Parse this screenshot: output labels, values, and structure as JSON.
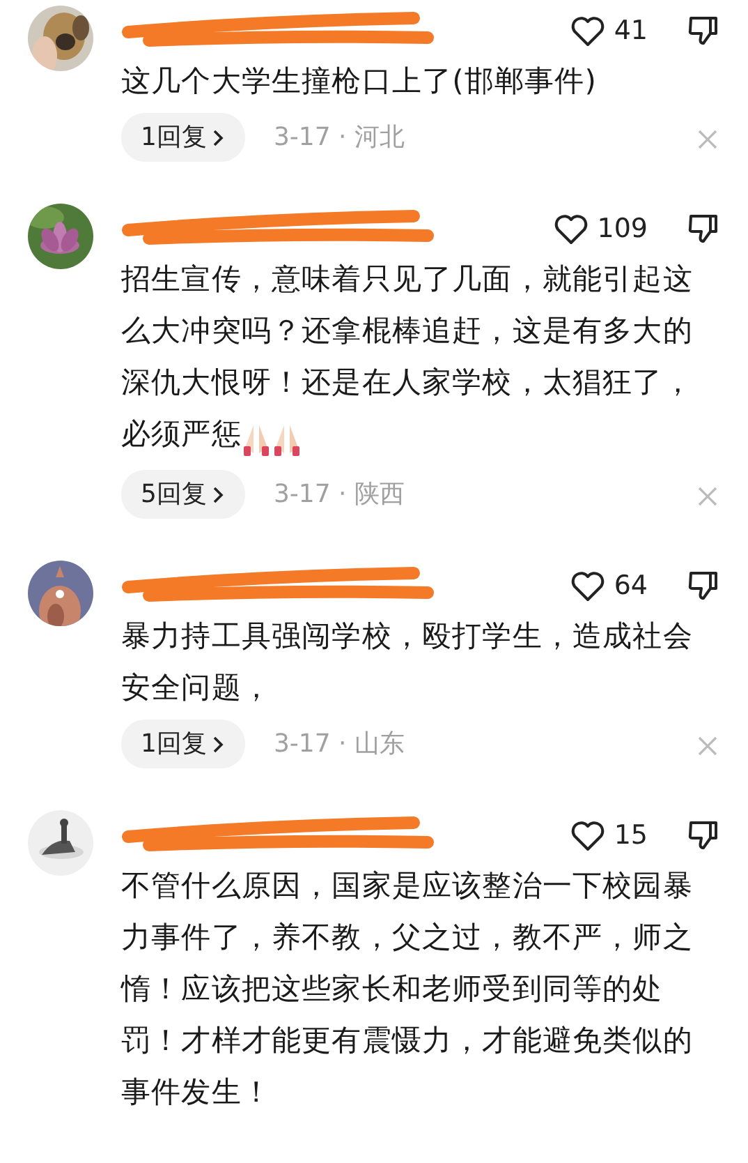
{
  "comments": [
    {
      "likes": "41",
      "text": "这几个大学生撞枪口上了(邯郸事件)",
      "replies": "1回复",
      "meta": "3-17 · 河北"
    },
    {
      "likes": "109",
      "text": "招生宣传，意味着只见了几面，就能引起这么大冲突吗？还拿棍棒追赶，这是有多大的深仇大恨呀！还是在人家学校，太猖狂了，必须严惩",
      "praying_hands": true,
      "replies": "5回复",
      "meta": "3-17 · 陕西"
    },
    {
      "likes": "64",
      "text": "暴力持工具强闯学校，殴打学生，造成社会安全问题，",
      "replies": "1回复",
      "meta": "3-17 · 山东"
    },
    {
      "likes": "15",
      "text": "不管什么原因，国家是应该整治一下校园暴力事件了，养不教，父之过，教不严，师之惰！应该把这些家长和老师受到同等的处罚！才样才能更有震慑力，才能避免类似的事件发生！"
    }
  ]
}
